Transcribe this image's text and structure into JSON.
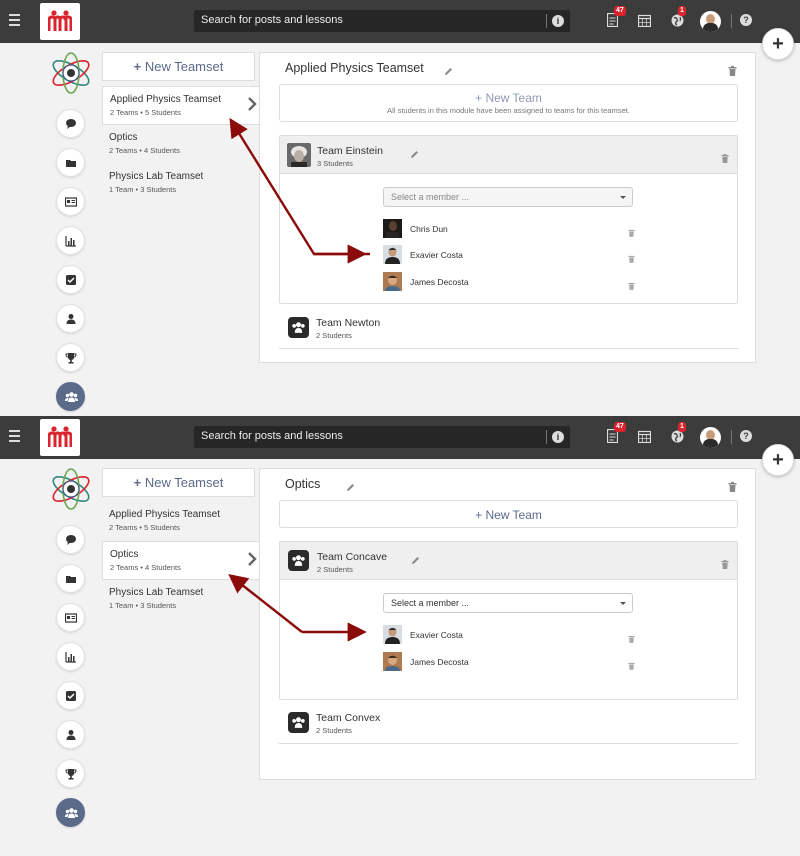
{
  "common": {
    "search_placeholder": "Search for posts and lessons",
    "notification_badge": "47",
    "globe_badge": "1",
    "help_glyph": "?",
    "info_glyph": "i",
    "add_glyph": "+",
    "new_teamset_label": "New Teamset",
    "plus_glyph": "+",
    "icons": [
      "menu-icon",
      "logo-icon",
      "info-icon",
      "document-icon",
      "calendar-icon",
      "globe-icon",
      "user-avatar",
      "help-icon",
      "add-icon",
      "chat-icon",
      "folder-icon",
      "id-card-icon",
      "chart-icon",
      "checkbox-icon",
      "user-icon",
      "trophy-icon",
      "teams-icon",
      "pencil-icon",
      "trash-icon",
      "chevron-right-icon"
    ],
    "colors": {
      "topbar": "#3c3c3c",
      "accent": "#5c6a8a",
      "badge": "#d9232d",
      "arrow": "#8b0a0a",
      "logo": "#d9232d"
    }
  },
  "panel_top": {
    "teamsets": [
      {
        "name": "Applied Physics Teamset",
        "meta": "2 Teams • 5 Students",
        "active": true
      },
      {
        "name": "Optics",
        "meta": "2 Teams • 4 Students",
        "active": false
      },
      {
        "name": "Physics Lab Teamset",
        "meta": "1 Team • 3 Students",
        "active": false
      }
    ],
    "title": "Applied Physics Teamset",
    "new_team_label": "New Team",
    "new_team_note": "All students in this module have been assigned to teams for this teamset.",
    "expanded_team": {
      "name": "Team Einstein",
      "meta": "3 Students",
      "select_placeholder": "Select a member ...",
      "members": [
        "Chris Dun",
        "Exavier Costa",
        "James Decosta"
      ]
    },
    "collapsed_team": {
      "name": "Team Newton",
      "meta": "2 Students"
    }
  },
  "panel_bottom": {
    "teamsets": [
      {
        "name": "Applied Physics Teamset",
        "meta": "2 Teams • 5 Students",
        "active": false
      },
      {
        "name": "Optics",
        "meta": "2 Teams • 4 Students",
        "active": true
      },
      {
        "name": "Physics Lab Teamset",
        "meta": "1 Team • 3 Students",
        "active": false
      }
    ],
    "title": "Optics",
    "new_team_label": "New Team",
    "expanded_team": {
      "name": "Team Concave",
      "meta": "2 Students",
      "select_placeholder": "Select a member ...",
      "members": [
        "Exavier Costa",
        "James Decosta"
      ]
    },
    "collapsed_team": {
      "name": "Team Convex",
      "meta": "2 Students"
    }
  }
}
